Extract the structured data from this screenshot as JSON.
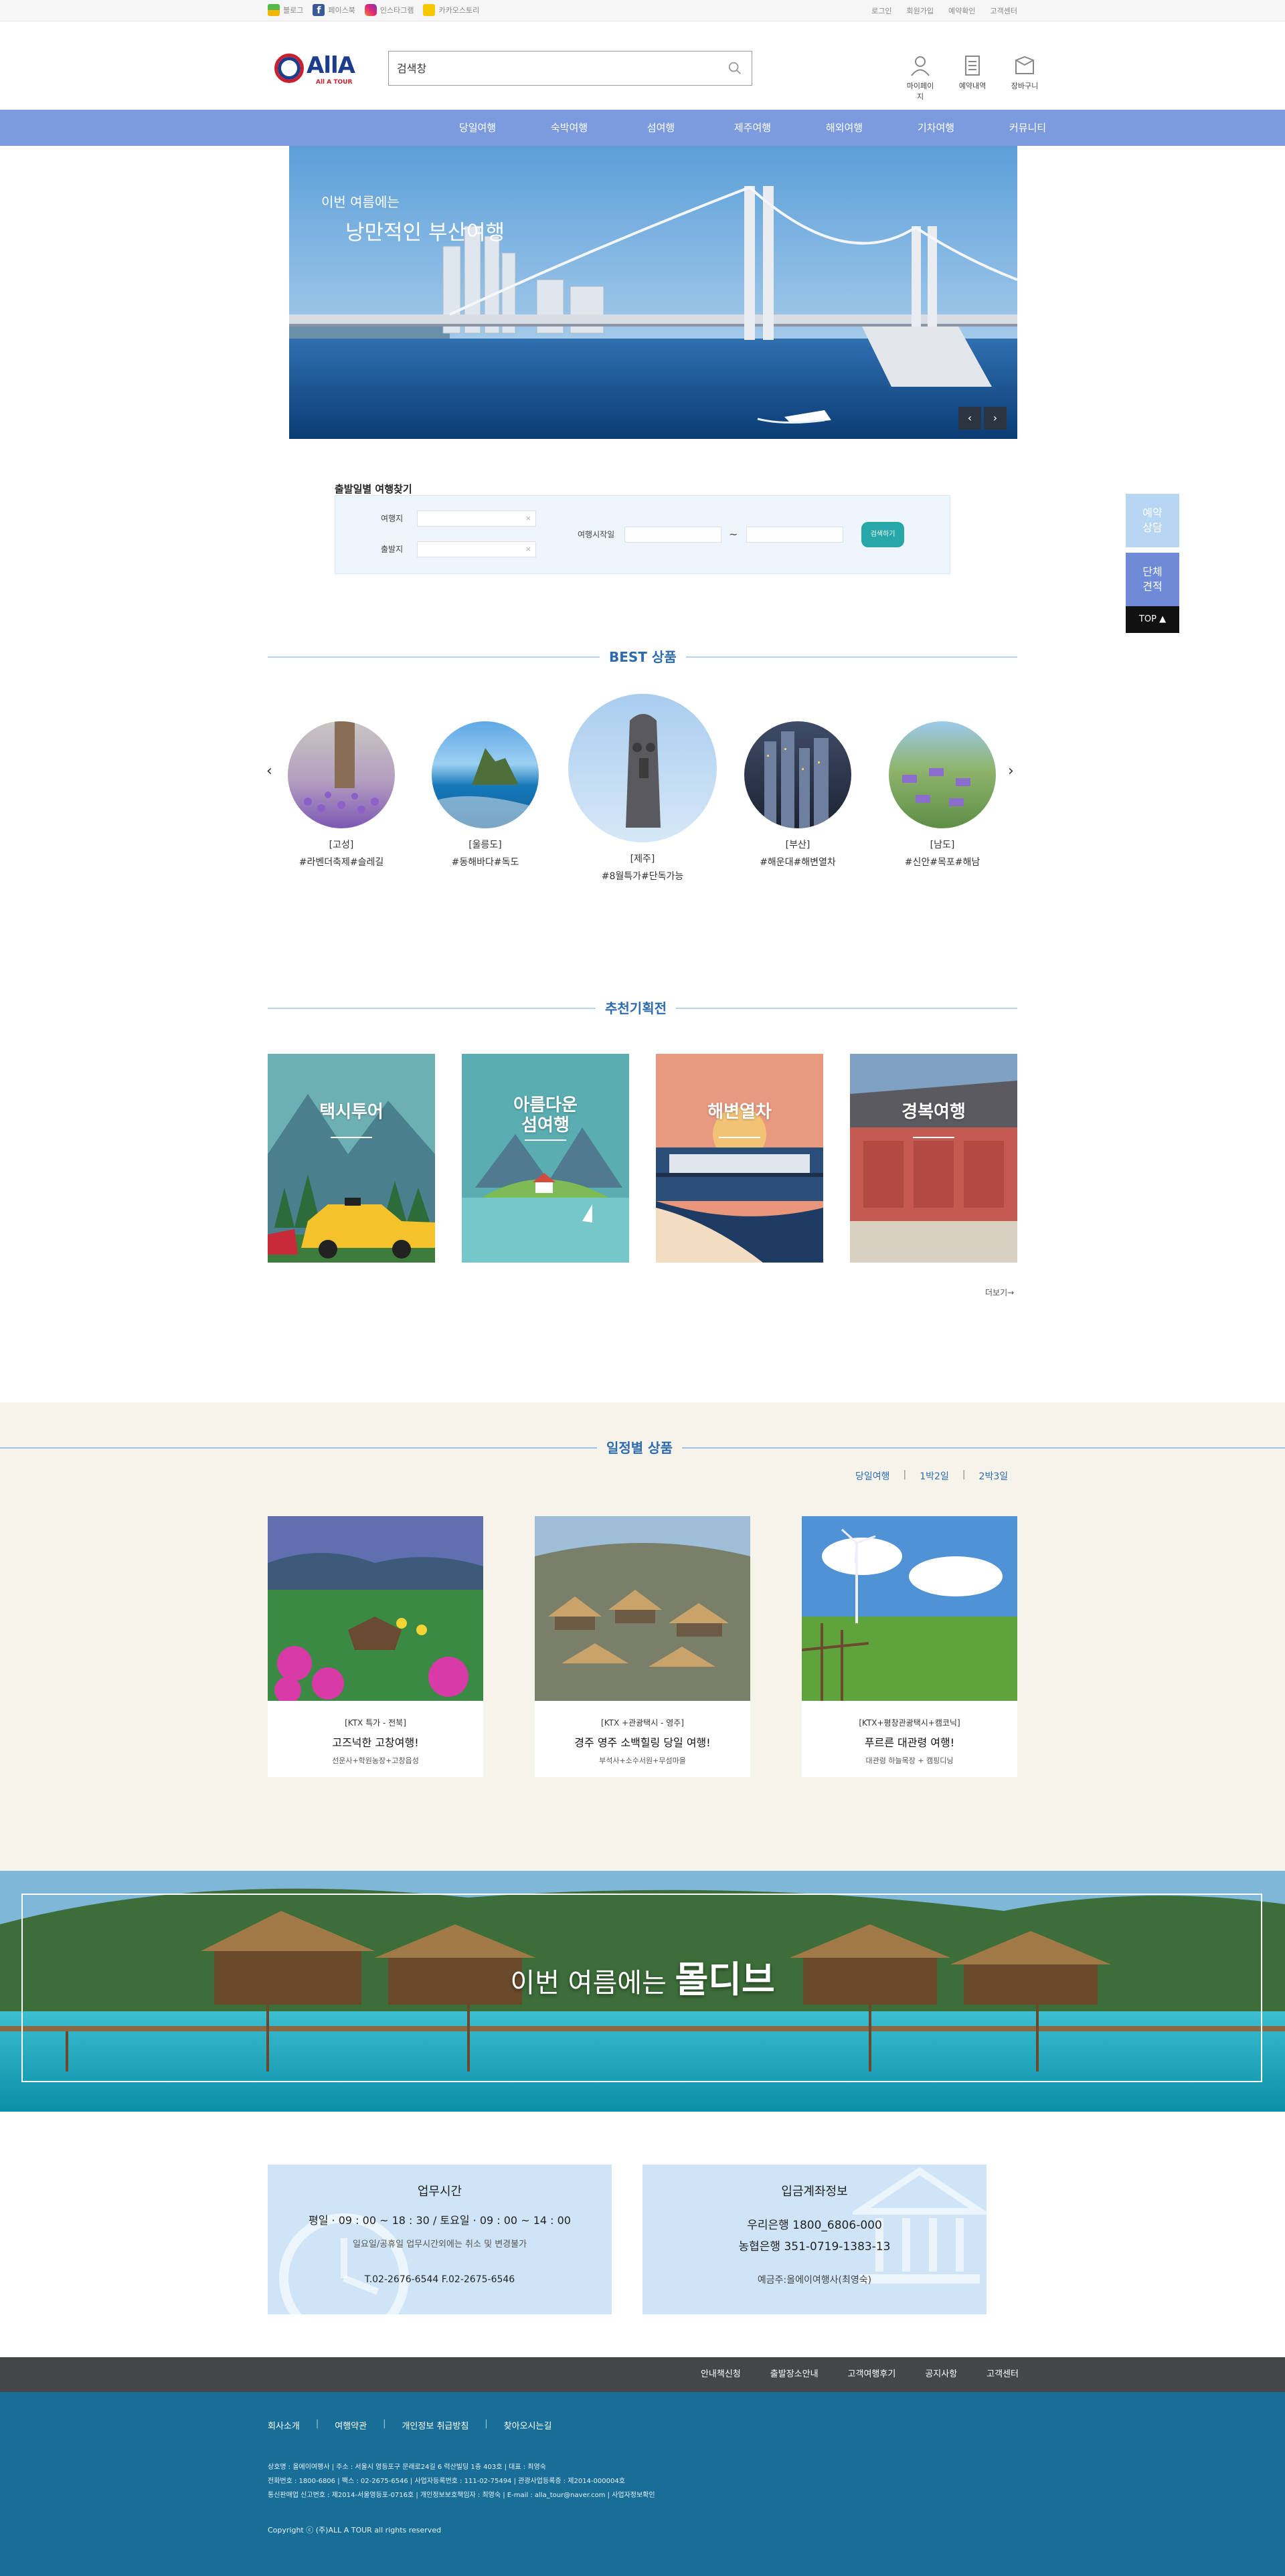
{
  "util": {
    "sns": [
      "블로그",
      "페이스북",
      "인스타그램",
      "카카오스토리"
    ],
    "links": [
      "로그인",
      "회원가입",
      "예약확인",
      "고객센터"
    ]
  },
  "header": {
    "logo_text": "AllA",
    "logo_sub": "All A TOUR",
    "search_value": "검색창",
    "icons": [
      {
        "label": "마이페이지",
        "icon": "user-icon"
      },
      {
        "label": "예약내역",
        "icon": "document-icon"
      },
      {
        "label": "장바구니",
        "icon": "bag-icon"
      }
    ]
  },
  "nav": [
    "당일여행",
    "숙박여행",
    "섬여행",
    "제주여행",
    "해외여행",
    "기차여행",
    "커뮤니티"
  ],
  "hero": {
    "caption_small": "이번 여름에는",
    "caption_large": "낭만적인 부산여행",
    "prev": "‹",
    "next": "›"
  },
  "quick_search": {
    "title": "출발일별 여행찾기",
    "destination_label": "여행지",
    "departure_label": "출발지",
    "date_label": "여행시작일",
    "tilde": "~",
    "submit_label": "검색하기"
  },
  "side_quick": {
    "reserve": "예약\n상담",
    "group": "단체\n견적",
    "top": "TOP ▲"
  },
  "best": {
    "title": "BEST 상품",
    "items": [
      {
        "region": "[고성]",
        "tags": "#라벤더축제#슬레길"
      },
      {
        "region": "[울릉도]",
        "tags": "#동해바다#독도"
      },
      {
        "region": "[제주]",
        "tags": "#8월특가#단독가능"
      },
      {
        "region": "[부산]",
        "tags": "#해운대#해변열차"
      },
      {
        "region": "[남도]",
        "tags": "#신안#목포#해남"
      }
    ],
    "prev": "‹",
    "next": "›"
  },
  "promo": {
    "title": "추천기획전",
    "cards": [
      {
        "title": "택시투어"
      },
      {
        "title": "아름다운\n섬여행"
      },
      {
        "title": "해변열차"
      },
      {
        "title": "경복여행"
      }
    ],
    "more": "더보기→"
  },
  "schedule": {
    "title": "일정별 상품",
    "tabs": [
      "당일여행",
      "1박2일",
      "2박3일"
    ],
    "separator": "|",
    "products": [
      {
        "cat": "[KTX 특가 - 전북]",
        "name": "고즈넉한 고창여행!",
        "route": "선운사+학원농장+고창읍성"
      },
      {
        "cat": "[KTX +관광택시 - 영주]",
        "name": "경주 영주 소백힐링 당일 여행!",
        "route": "부석사+소수서원+무섬마을"
      },
      {
        "cat": "[KTX+평창관광택시+캠코닉]",
        "name": "푸르른 대관령 여행!",
        "route": "대관령 하늘목장 + 캠핑디닝"
      }
    ]
  },
  "banner": {
    "text_pre": "이번 여름에는",
    "text_bold": "몰디브"
  },
  "hours": {
    "title": "업무시간",
    "hours": "평일 · 09 : 00 ~ 18 : 30  /  토요일 · 09 : 00 ~ 14 : 00",
    "note": "일요일/공휴일 업무시간외에는 취소 및 변경불가",
    "phone": "T.02-2676-6544  F.02-2675-6546"
  },
  "bank": {
    "title": "입금계좌정보",
    "line1": "우리은행 1800_6806-000",
    "line2": "농협은행 351-0719-1383-13",
    "holder": "예금주:올에이여행사(최영숙)"
  },
  "footer_nav": [
    "안내책신청",
    "출발장소안내",
    "고객여행후기",
    "공지사항",
    "고객센터"
  ],
  "footer": {
    "links": [
      "회사소개",
      "여행약관",
      "개인정보 취급방침",
      "찾아오시는길"
    ],
    "info": [
      "상호명 : 올에이여행사  |  주소 : 서울시 영등포구 문래로24길 6 력산빌딩 1층 403호 | 대표 : 최영숙",
      "전화번호 : 1800-6806 | 팩스 : 02-2675-6546 | 사업자등록번호 : 111-02-75494 | 관광사업등록증 : 제2014-000004호",
      "통신판매업 신고번호 : 제2014-서울영등포-0716호 | 개인정보보호책임자 : 최영숙 | E-mail : alla_tour@naver.com | 사업자정보확인"
    ],
    "copyright": "Copyright ⓒ (주)ALL A TOUR all rights reserved"
  }
}
